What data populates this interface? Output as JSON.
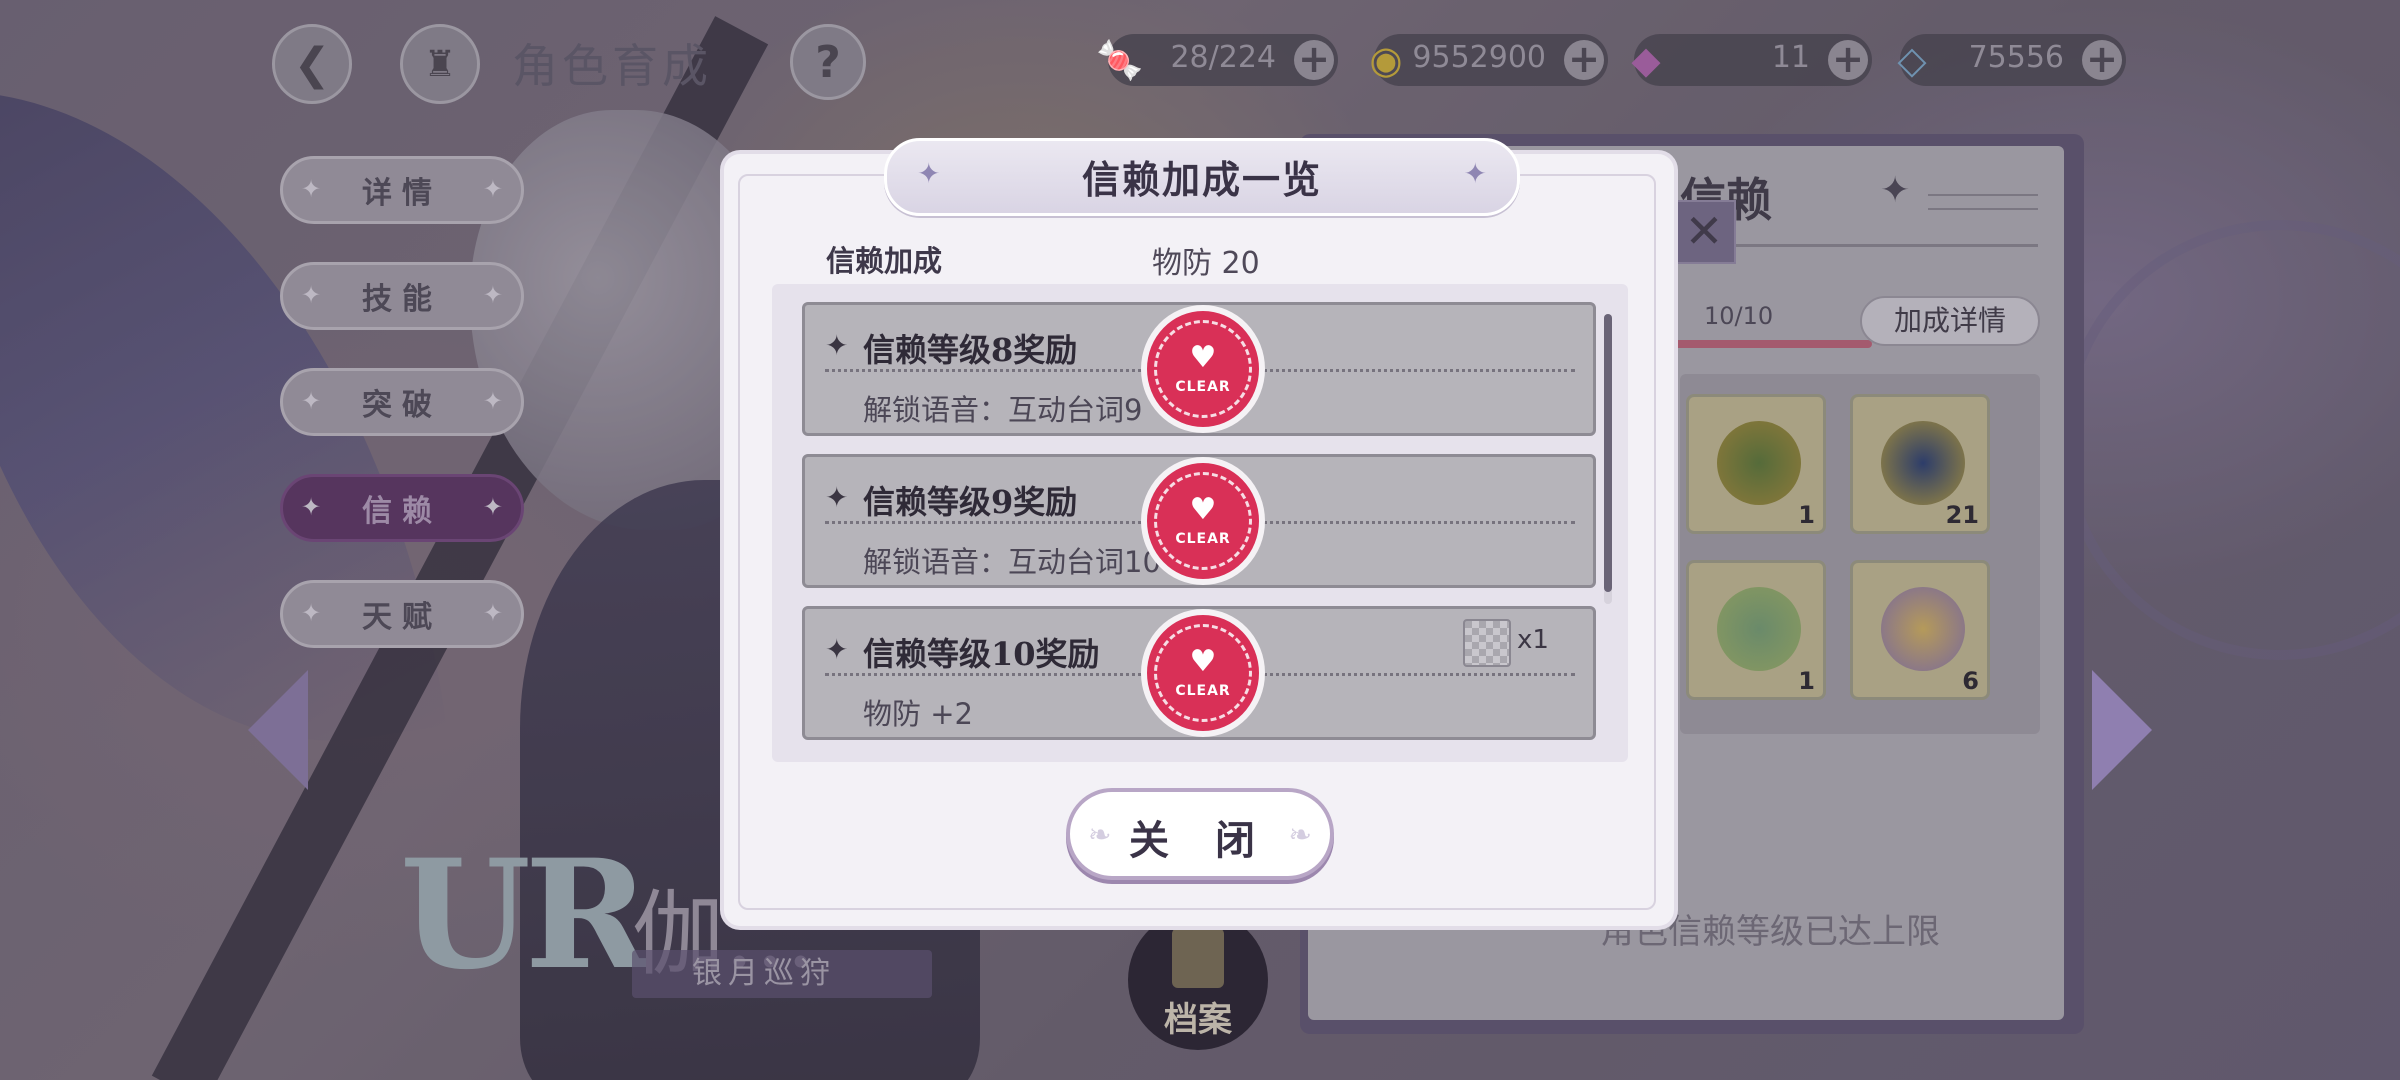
{
  "top": {
    "page_title": "角色育成",
    "back_icon": "back-arrow-icon",
    "home_icon": "castle-icon",
    "help_label": "?",
    "resources": [
      {
        "icon": "candy-icon",
        "value": "28/224"
      },
      {
        "icon": "gold-coin-icon",
        "value": "9552900"
      },
      {
        "icon": "rainbow-gem-icon",
        "value": "11"
      },
      {
        "icon": "diamond-icon",
        "value": "75556"
      }
    ],
    "plus_label": "+"
  },
  "menu": {
    "items": [
      {
        "label": "详情",
        "active": false
      },
      {
        "label": "技能",
        "active": false
      },
      {
        "label": "突破",
        "active": false
      },
      {
        "label": "信赖",
        "active": true
      },
      {
        "label": "天赋",
        "active": false
      }
    ]
  },
  "character": {
    "rarity": "UR",
    "name": "伽…",
    "title": "银月巡狩",
    "archive_label": "档案"
  },
  "trust_panel": {
    "title": "信赖",
    "level": "10/10",
    "progress": 1.0,
    "detail_button": "加成详情",
    "items": [
      {
        "count": "1",
        "icon": "binoculars-icon"
      },
      {
        "count": "21",
        "icon": "pocket-watch-icon"
      },
      {
        "count": "1",
        "icon": "potion-bottle-icon"
      },
      {
        "count": "6",
        "icon": "perfume-bottle-icon"
      }
    ],
    "max_text": "角色信赖等级已达上限"
  },
  "modal": {
    "title": "信赖加成一览",
    "bonus_label": "信赖加成",
    "bonus_value": "物防 20",
    "rows": [
      {
        "title": "信赖等级8奖励",
        "desc": "解锁语音：互动台词9",
        "stamp": "CLEAR",
        "reward_qty": ""
      },
      {
        "title": "信赖等级9奖励",
        "desc": "解锁语音：互动台词10",
        "stamp": "CLEAR",
        "reward_qty": ""
      },
      {
        "title": "信赖等级10奖励",
        "desc": "物防 +2",
        "stamp": "CLEAR",
        "reward_qty": "x1"
      }
    ],
    "close_button": "关 闭",
    "scroll_position": 1.0
  },
  "colors": {
    "accent_purple": "#56355e",
    "stamp_red": "#d93057",
    "modal_bg": "#f3f1f6"
  }
}
